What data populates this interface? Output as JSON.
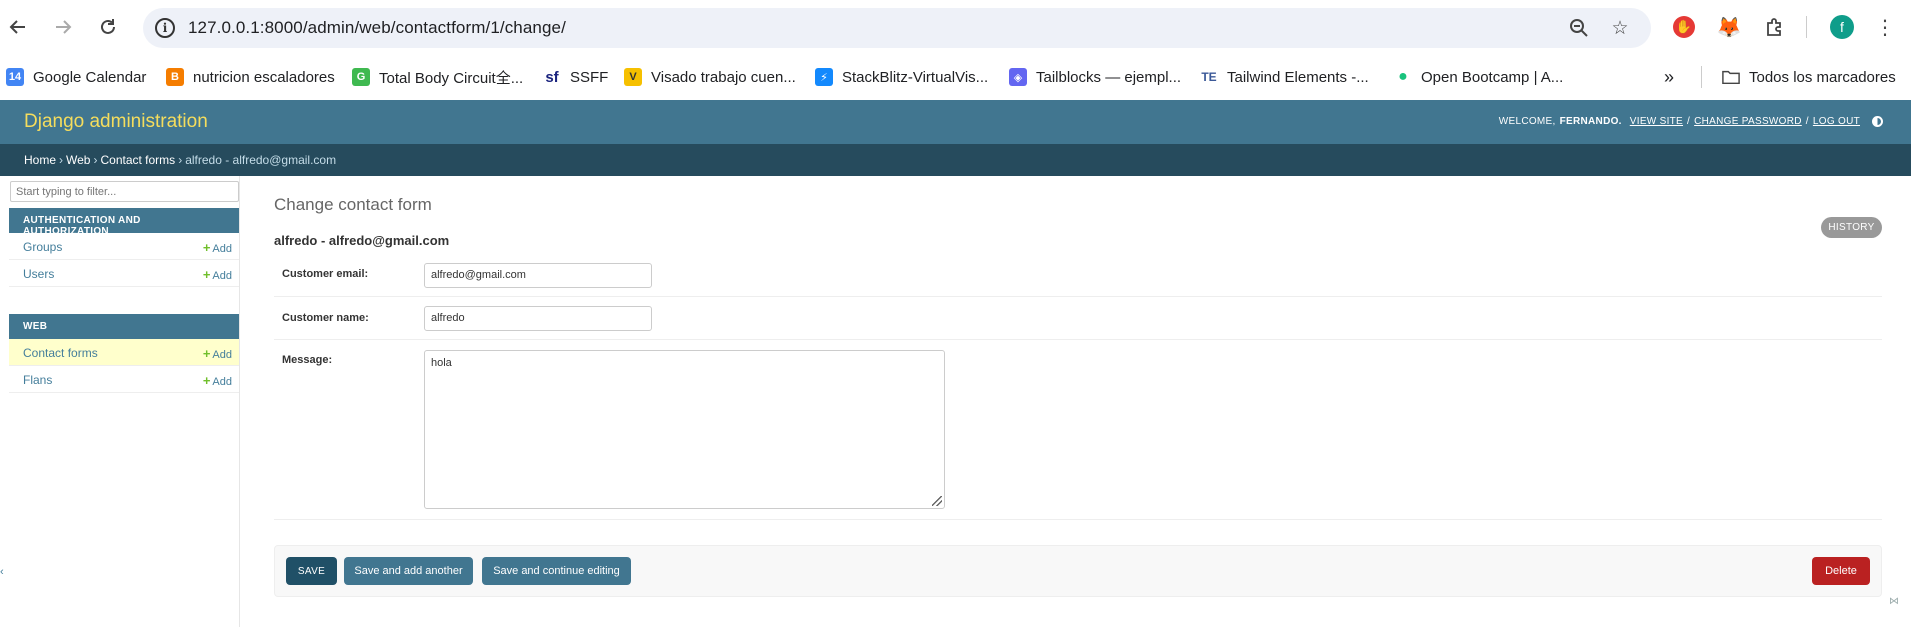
{
  "browser": {
    "url": "127.0.0.1:8000/admin/web/contactform/1/change/",
    "profile_initial": "f",
    "bookmarks": [
      {
        "label": "Google Calendar",
        "icon": "calendar-icon",
        "color": "#4285f4",
        "glyph": "14"
      },
      {
        "label": "nutricion escaladores",
        "icon": "blogger-icon",
        "color": "#f57d00",
        "glyph": "B"
      },
      {
        "label": "Total Body Circuit全...",
        "icon": "gym-icon",
        "color": "#3fb950",
        "glyph": "G"
      },
      {
        "label": "SSFF",
        "icon": "sf-icon",
        "color": "#1a237e",
        "glyph": "sf"
      },
      {
        "label": "Visado trabajo cuen...",
        "icon": "visa-icon",
        "color": "#f6c000",
        "glyph": "V"
      },
      {
        "label": "StackBlitz-VirtualVis...",
        "icon": "stackblitz-icon",
        "color": "#1389fd",
        "glyph": "⚡"
      },
      {
        "label": "Tailblocks — ejempl...",
        "icon": "tailblocks-icon",
        "color": "#6366f1",
        "glyph": "◈"
      },
      {
        "label": "Tailwind Elements -...",
        "icon": "tailwind-elements-icon",
        "color": "#3b5998",
        "glyph": "TE"
      },
      {
        "label": "Open Bootcamp | A...",
        "icon": "open-bootcamp-icon",
        "color": "#19c37d",
        "glyph": "●"
      }
    ],
    "all_bookmarks_label": "Todos los marcadores"
  },
  "admin": {
    "brand": "Django administration",
    "welcome": "WELCOME,",
    "username": "FERNANDO.",
    "view_site": "VIEW SITE",
    "change_password": "CHANGE PASSWORD",
    "log_out": "LOG OUT",
    "slash": "/",
    "breadcrumbs": {
      "home": "Home",
      "app": "Web",
      "model": "Contact forms",
      "current": "alfredo - alfredo@gmail.com",
      "sep": "›"
    }
  },
  "sidebar": {
    "filter_placeholder": "Start typing to filter...",
    "apps": [
      {
        "caption": "AUTHENTICATION AND AUTHORIZATION",
        "models": [
          {
            "name": "Groups",
            "add": "Add"
          },
          {
            "name": "Users",
            "add": "Add"
          }
        ]
      },
      {
        "caption": "WEB",
        "models": [
          {
            "name": "Contact forms",
            "add": "Add",
            "current": true
          },
          {
            "name": "Flans",
            "add": "Add"
          }
        ]
      }
    ]
  },
  "content": {
    "title": "Change contact form",
    "object_title": "alfredo - alfredo@gmail.com",
    "history_label": "HISTORY",
    "fields": {
      "customer_email": {
        "label": "Customer email:",
        "value": "alfredo@gmail.com"
      },
      "customer_name": {
        "label": "Customer name:",
        "value": "alfredo"
      },
      "message": {
        "label": "Message:",
        "value": "hola"
      }
    },
    "buttons": {
      "save": "SAVE",
      "save_add_another": "Save and add another",
      "save_continue": "Save and continue editing",
      "delete": "Delete"
    }
  },
  "colors": {
    "header": "#417690",
    "breadcrumbs": "#264b5d",
    "brand": "#f5dd5d",
    "delete": "#ba2121",
    "save": "#205067"
  }
}
